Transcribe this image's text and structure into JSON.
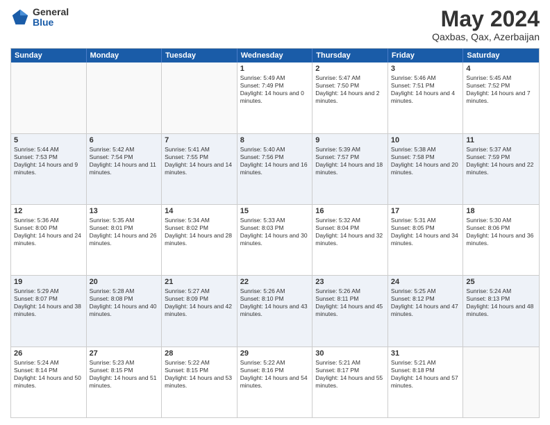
{
  "logo": {
    "general": "General",
    "blue": "Blue"
  },
  "title": "May 2024",
  "location": "Qaxbas, Qax, Azerbaijan",
  "header_days": [
    "Sunday",
    "Monday",
    "Tuesday",
    "Wednesday",
    "Thursday",
    "Friday",
    "Saturday"
  ],
  "weeks": [
    [
      {
        "day": "",
        "sunrise": "",
        "sunset": "",
        "daylight": ""
      },
      {
        "day": "",
        "sunrise": "",
        "sunset": "",
        "daylight": ""
      },
      {
        "day": "",
        "sunrise": "",
        "sunset": "",
        "daylight": ""
      },
      {
        "day": "1",
        "sunrise": "Sunrise: 5:49 AM",
        "sunset": "Sunset: 7:49 PM",
        "daylight": "Daylight: 14 hours and 0 minutes."
      },
      {
        "day": "2",
        "sunrise": "Sunrise: 5:47 AM",
        "sunset": "Sunset: 7:50 PM",
        "daylight": "Daylight: 14 hours and 2 minutes."
      },
      {
        "day": "3",
        "sunrise": "Sunrise: 5:46 AM",
        "sunset": "Sunset: 7:51 PM",
        "daylight": "Daylight: 14 hours and 4 minutes."
      },
      {
        "day": "4",
        "sunrise": "Sunrise: 5:45 AM",
        "sunset": "Sunset: 7:52 PM",
        "daylight": "Daylight: 14 hours and 7 minutes."
      }
    ],
    [
      {
        "day": "5",
        "sunrise": "Sunrise: 5:44 AM",
        "sunset": "Sunset: 7:53 PM",
        "daylight": "Daylight: 14 hours and 9 minutes."
      },
      {
        "day": "6",
        "sunrise": "Sunrise: 5:42 AM",
        "sunset": "Sunset: 7:54 PM",
        "daylight": "Daylight: 14 hours and 11 minutes."
      },
      {
        "day": "7",
        "sunrise": "Sunrise: 5:41 AM",
        "sunset": "Sunset: 7:55 PM",
        "daylight": "Daylight: 14 hours and 14 minutes."
      },
      {
        "day": "8",
        "sunrise": "Sunrise: 5:40 AM",
        "sunset": "Sunset: 7:56 PM",
        "daylight": "Daylight: 14 hours and 16 minutes."
      },
      {
        "day": "9",
        "sunrise": "Sunrise: 5:39 AM",
        "sunset": "Sunset: 7:57 PM",
        "daylight": "Daylight: 14 hours and 18 minutes."
      },
      {
        "day": "10",
        "sunrise": "Sunrise: 5:38 AM",
        "sunset": "Sunset: 7:58 PM",
        "daylight": "Daylight: 14 hours and 20 minutes."
      },
      {
        "day": "11",
        "sunrise": "Sunrise: 5:37 AM",
        "sunset": "Sunset: 7:59 PM",
        "daylight": "Daylight: 14 hours and 22 minutes."
      }
    ],
    [
      {
        "day": "12",
        "sunrise": "Sunrise: 5:36 AM",
        "sunset": "Sunset: 8:00 PM",
        "daylight": "Daylight: 14 hours and 24 minutes."
      },
      {
        "day": "13",
        "sunrise": "Sunrise: 5:35 AM",
        "sunset": "Sunset: 8:01 PM",
        "daylight": "Daylight: 14 hours and 26 minutes."
      },
      {
        "day": "14",
        "sunrise": "Sunrise: 5:34 AM",
        "sunset": "Sunset: 8:02 PM",
        "daylight": "Daylight: 14 hours and 28 minutes."
      },
      {
        "day": "15",
        "sunrise": "Sunrise: 5:33 AM",
        "sunset": "Sunset: 8:03 PM",
        "daylight": "Daylight: 14 hours and 30 minutes."
      },
      {
        "day": "16",
        "sunrise": "Sunrise: 5:32 AM",
        "sunset": "Sunset: 8:04 PM",
        "daylight": "Daylight: 14 hours and 32 minutes."
      },
      {
        "day": "17",
        "sunrise": "Sunrise: 5:31 AM",
        "sunset": "Sunset: 8:05 PM",
        "daylight": "Daylight: 14 hours and 34 minutes."
      },
      {
        "day": "18",
        "sunrise": "Sunrise: 5:30 AM",
        "sunset": "Sunset: 8:06 PM",
        "daylight": "Daylight: 14 hours and 36 minutes."
      }
    ],
    [
      {
        "day": "19",
        "sunrise": "Sunrise: 5:29 AM",
        "sunset": "Sunset: 8:07 PM",
        "daylight": "Daylight: 14 hours and 38 minutes."
      },
      {
        "day": "20",
        "sunrise": "Sunrise: 5:28 AM",
        "sunset": "Sunset: 8:08 PM",
        "daylight": "Daylight: 14 hours and 40 minutes."
      },
      {
        "day": "21",
        "sunrise": "Sunrise: 5:27 AM",
        "sunset": "Sunset: 8:09 PM",
        "daylight": "Daylight: 14 hours and 42 minutes."
      },
      {
        "day": "22",
        "sunrise": "Sunrise: 5:26 AM",
        "sunset": "Sunset: 8:10 PM",
        "daylight": "Daylight: 14 hours and 43 minutes."
      },
      {
        "day": "23",
        "sunrise": "Sunrise: 5:26 AM",
        "sunset": "Sunset: 8:11 PM",
        "daylight": "Daylight: 14 hours and 45 minutes."
      },
      {
        "day": "24",
        "sunrise": "Sunrise: 5:25 AM",
        "sunset": "Sunset: 8:12 PM",
        "daylight": "Daylight: 14 hours and 47 minutes."
      },
      {
        "day": "25",
        "sunrise": "Sunrise: 5:24 AM",
        "sunset": "Sunset: 8:13 PM",
        "daylight": "Daylight: 14 hours and 48 minutes."
      }
    ],
    [
      {
        "day": "26",
        "sunrise": "Sunrise: 5:24 AM",
        "sunset": "Sunset: 8:14 PM",
        "daylight": "Daylight: 14 hours and 50 minutes."
      },
      {
        "day": "27",
        "sunrise": "Sunrise: 5:23 AM",
        "sunset": "Sunset: 8:15 PM",
        "daylight": "Daylight: 14 hours and 51 minutes."
      },
      {
        "day": "28",
        "sunrise": "Sunrise: 5:22 AM",
        "sunset": "Sunset: 8:15 PM",
        "daylight": "Daylight: 14 hours and 53 minutes."
      },
      {
        "day": "29",
        "sunrise": "Sunrise: 5:22 AM",
        "sunset": "Sunset: 8:16 PM",
        "daylight": "Daylight: 14 hours and 54 minutes."
      },
      {
        "day": "30",
        "sunrise": "Sunrise: 5:21 AM",
        "sunset": "Sunset: 8:17 PM",
        "daylight": "Daylight: 14 hours and 55 minutes."
      },
      {
        "day": "31",
        "sunrise": "Sunrise: 5:21 AM",
        "sunset": "Sunset: 8:18 PM",
        "daylight": "Daylight: 14 hours and 57 minutes."
      },
      {
        "day": "",
        "sunrise": "",
        "sunset": "",
        "daylight": ""
      }
    ]
  ]
}
